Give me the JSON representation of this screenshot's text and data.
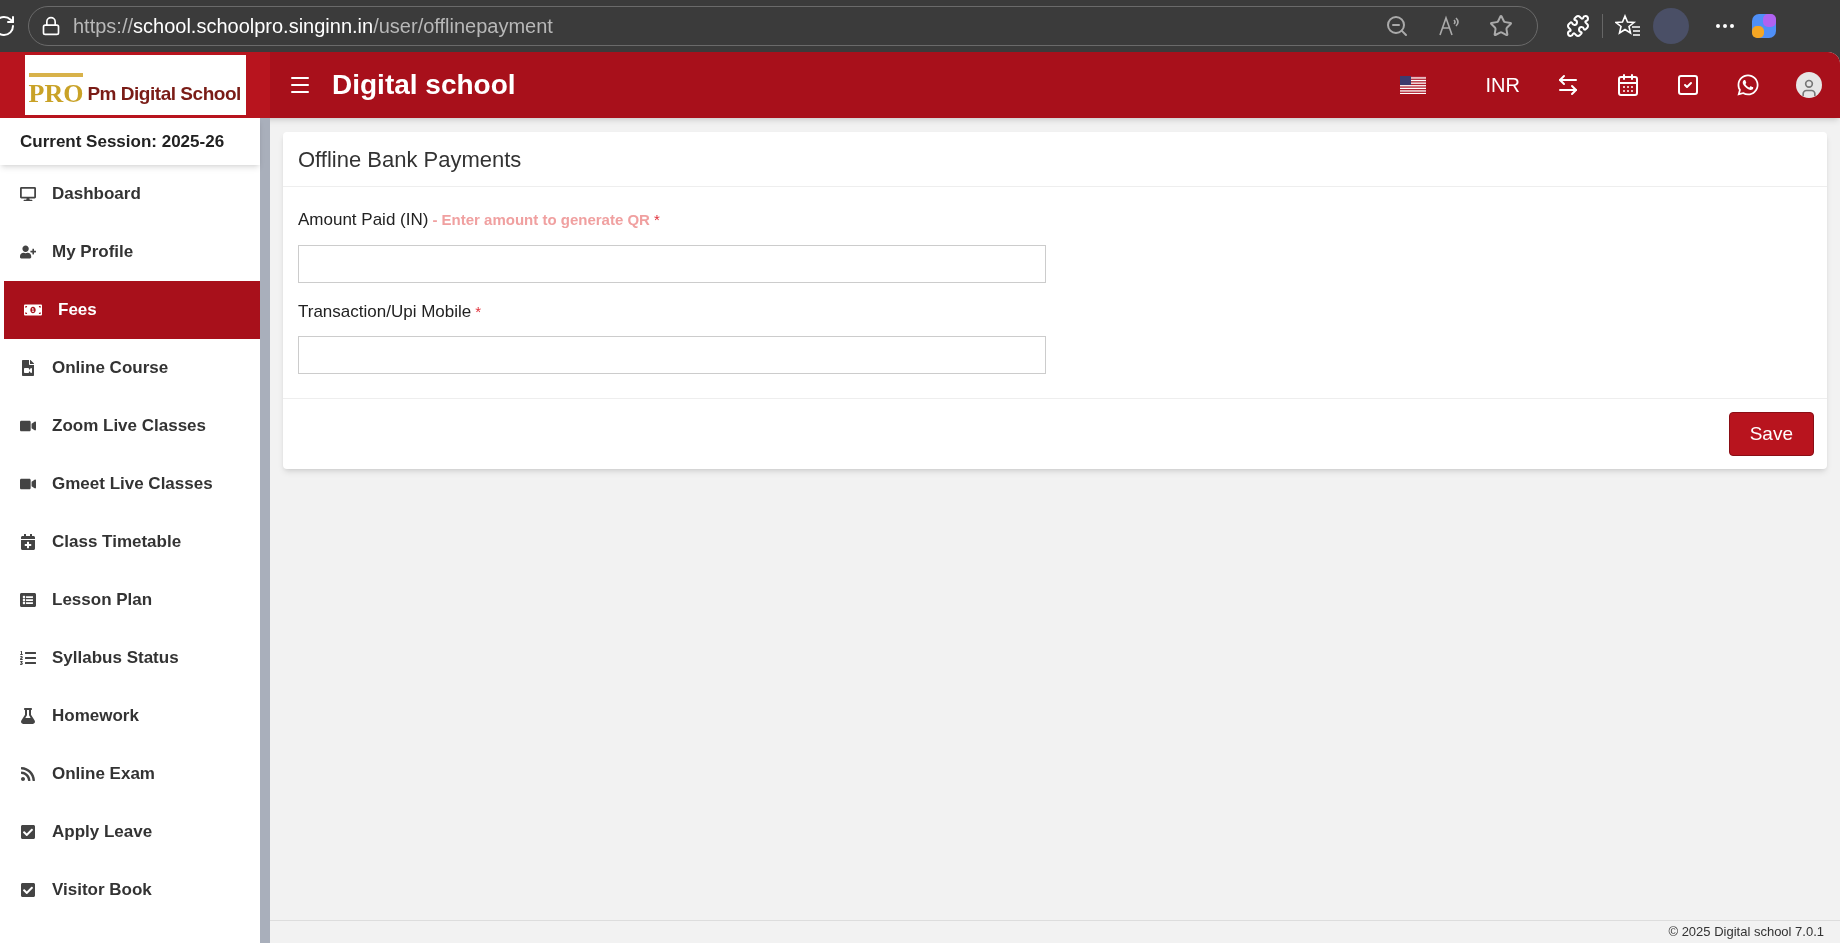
{
  "browser": {
    "url_scheme": "https://",
    "url_host": "school.schoolpro.singinn.in",
    "url_path": "/user/offlinepayment"
  },
  "logo": {
    "badge": "PRO",
    "name": "Pm Digital School"
  },
  "header": {
    "title": "Digital school",
    "currency": "INR"
  },
  "sidebar": {
    "session": "Current Session: 2025-26",
    "items": [
      {
        "label": "Dashboard",
        "selected": false
      },
      {
        "label": "My Profile",
        "selected": false
      },
      {
        "label": "Fees",
        "selected": true
      },
      {
        "label": "Online Course",
        "selected": false
      },
      {
        "label": "Zoom Live Classes",
        "selected": false
      },
      {
        "label": "Gmeet Live Classes",
        "selected": false
      },
      {
        "label": "Class Timetable",
        "selected": false
      },
      {
        "label": "Lesson Plan",
        "selected": false
      },
      {
        "label": "Syllabus Status",
        "selected": false
      },
      {
        "label": "Homework",
        "selected": false
      },
      {
        "label": "Online Exam",
        "selected": false
      },
      {
        "label": "Apply Leave",
        "selected": false
      },
      {
        "label": "Visitor Book",
        "selected": false
      }
    ]
  },
  "card": {
    "title": "Offline Bank Payments",
    "fields": [
      {
        "label": "Amount Paid (IN)",
        "hint": "- Enter amount to generate QR",
        "required_mark": "*"
      },
      {
        "label": "Transaction/Upi Mobile",
        "required_mark": "*"
      }
    ],
    "save": "Save"
  },
  "footer": "© 2025 Digital school 7.0.1"
}
